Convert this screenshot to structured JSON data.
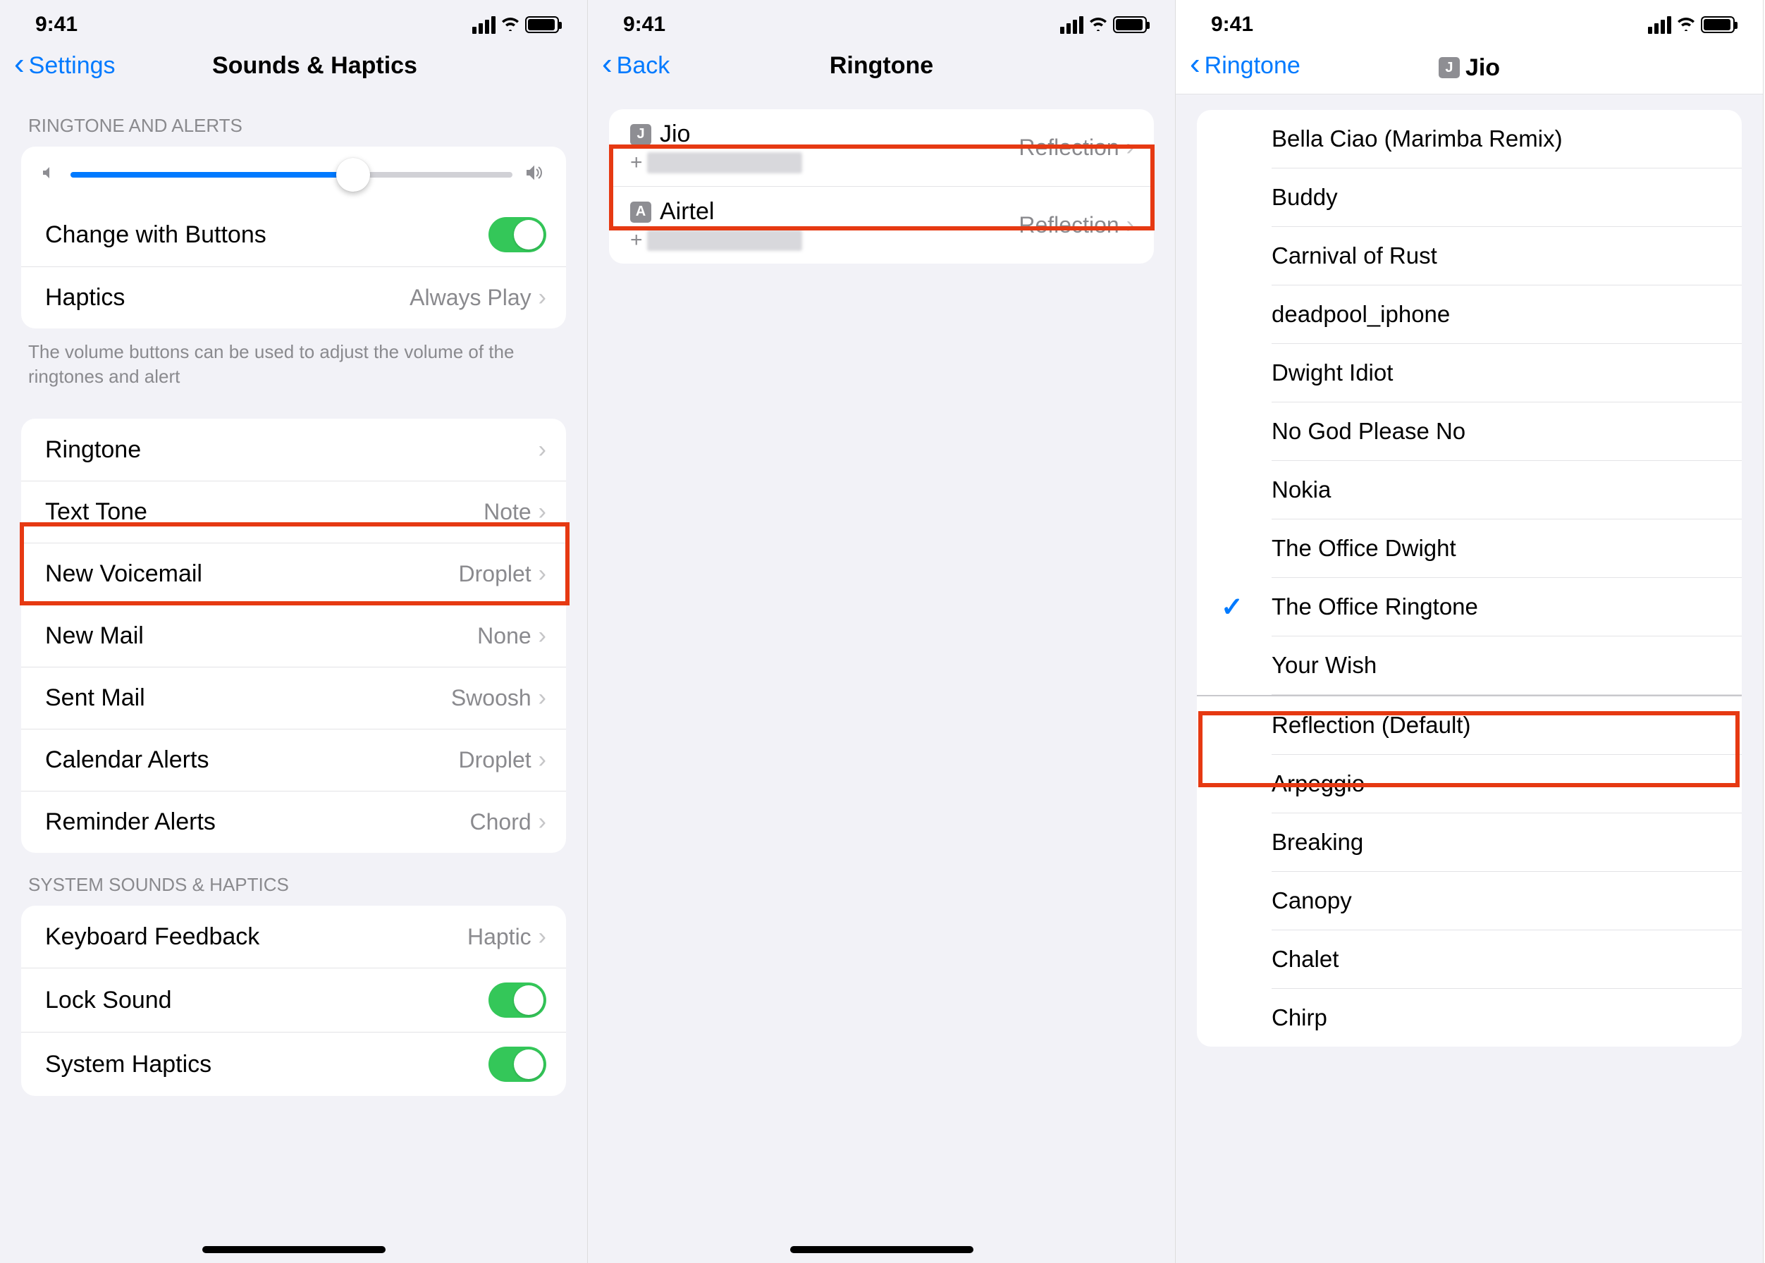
{
  "status": {
    "time": "9:41"
  },
  "screen1": {
    "back": "Settings",
    "title": "Sounds & Haptics",
    "section1_header": "RINGTONE AND ALERTS",
    "change_with_buttons": "Change with Buttons",
    "haptics_label": "Haptics",
    "haptics_value": "Always Play",
    "footer": "The volume buttons can be used to adjust the volume of the ringtones and alert",
    "sound_rows": [
      {
        "label": "Ringtone",
        "value": ""
      },
      {
        "label": "Text Tone",
        "value": "Note"
      },
      {
        "label": "New Voicemail",
        "value": "Droplet"
      },
      {
        "label": "New Mail",
        "value": "None"
      },
      {
        "label": "Sent Mail",
        "value": "Swoosh"
      },
      {
        "label": "Calendar Alerts",
        "value": "Droplet"
      },
      {
        "label": "Reminder Alerts",
        "value": "Chord"
      }
    ],
    "section3_header": "SYSTEM SOUNDS & HAPTICS",
    "keyboard_feedback": "Keyboard Feedback",
    "keyboard_feedback_value": "Haptic",
    "lock_sound": "Lock Sound",
    "system_haptics": "System Haptics"
  },
  "screen2": {
    "back": "Back",
    "title": "Ringtone",
    "sims": [
      {
        "badge": "J",
        "name": "Jio",
        "value": "Reflection"
      },
      {
        "badge": "A",
        "name": "Airtel",
        "value": "Reflection"
      }
    ],
    "number_prefix": "+"
  },
  "screen3": {
    "back": "Ringtone",
    "title_badge": "J",
    "title": "Jio",
    "custom_tones": [
      "Bella Ciao (Marimba Remix)",
      "Buddy",
      "Carnival of Rust",
      "deadpool_iphone",
      "Dwight Idiot",
      "No God Please No",
      "Nokia",
      "The Office Dwight",
      "The Office Ringtone",
      "Your Wish"
    ],
    "selected_index": 8,
    "system_tones": [
      "Reflection (Default)",
      "Arpeggio",
      "Breaking",
      "Canopy",
      "Chalet",
      "Chirp"
    ]
  }
}
